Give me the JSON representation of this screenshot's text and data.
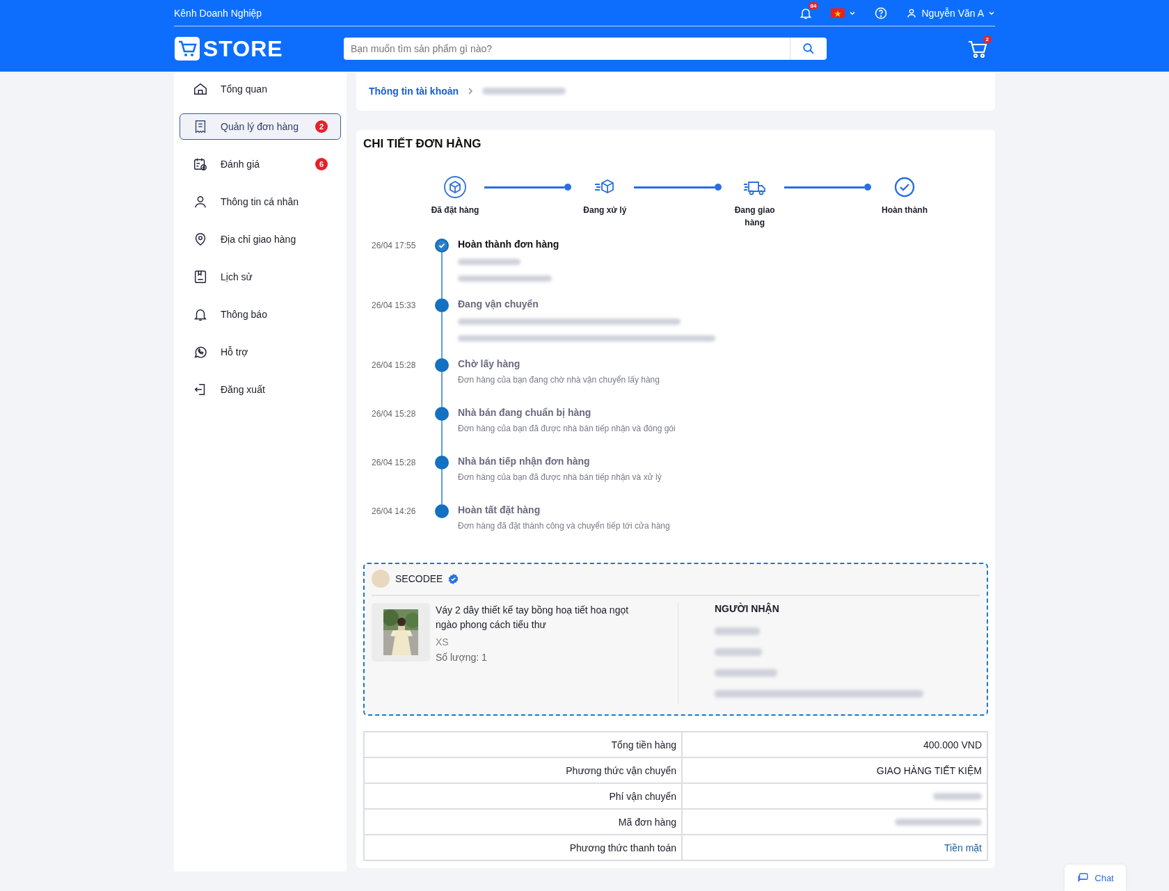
{
  "topbar": {
    "channel_link": "Kênh Doanh Nghiệp",
    "notification_count": "84",
    "user_name": "Nguyễn Văn A"
  },
  "header": {
    "logo_text": "STORE",
    "search": {
      "placeholder": "Bạn muốn tìm sản phẩm gì nào?"
    },
    "cart_count": "2"
  },
  "sidebar": {
    "items": [
      {
        "kind": "home",
        "label": "Tổng quan",
        "selected": false
      },
      {
        "kind": "orders",
        "label": "Quản lý đơn hàng",
        "selected": true,
        "badge": "2"
      },
      {
        "kind": "review",
        "label": "Đánh giá",
        "selected": false,
        "badge": "6"
      },
      {
        "kind": "user",
        "label": "Thông tin cá nhân",
        "selected": false
      },
      {
        "kind": "location",
        "label": "Địa chỉ giao hàng",
        "selected": false
      },
      {
        "kind": "history",
        "label": "Lịch sử",
        "selected": false
      },
      {
        "kind": "bell",
        "label": "Thông báo",
        "selected": false
      },
      {
        "kind": "support",
        "label": "Hỗ trợ",
        "selected": false
      },
      {
        "kind": "logout",
        "label": "Đăng xuất",
        "selected": false
      }
    ]
  },
  "breadcrumb": {
    "link": "Thông tin tài khoản",
    "current_redacted": true
  },
  "order": {
    "title": "CHI TIẾT ĐƠN HÀNG",
    "steps": [
      {
        "kind": "placed",
        "label": "Đã đặt hàng"
      },
      {
        "kind": "processing",
        "label": "Đang xử lý"
      },
      {
        "kind": "shipping",
        "label": "Đang giao hàng"
      },
      {
        "kind": "done",
        "label": "Hoàn thành"
      }
    ],
    "timeline": [
      {
        "time": "26/04 17:55",
        "title": "Hoàn thành đơn hàng",
        "current": true,
        "details": [
          {
            "kind": "redacted"
          },
          {
            "kind": "redacted"
          }
        ]
      },
      {
        "time": "26/04 15:33",
        "title": "Đang vận chuyển",
        "current": false,
        "details": [
          {
            "kind": "redacted"
          },
          {
            "kind": "redacted"
          }
        ]
      },
      {
        "time": "26/04 15:28",
        "title": "Chờ lấy hàng",
        "current": false,
        "details": [
          {
            "kind": "text",
            "text": "Đơn hàng của bạn đang chờ nhà vận chuyển lấy hàng"
          }
        ]
      },
      {
        "time": "26/04 15:28",
        "title": "Nhà bán đang chuẩn bị hàng",
        "current": false,
        "details": [
          {
            "kind": "text",
            "text": "Đơn hàng của bạn đã được nhà bán tiếp nhận và đóng gói"
          }
        ]
      },
      {
        "time": "26/04 15:28",
        "title": "Nhà bán tiếp nhận đơn hàng",
        "current": false,
        "details": [
          {
            "kind": "text",
            "text": "Đơn hàng của bạn đã được nhà bán tiếp nhận và xử lý"
          }
        ]
      },
      {
        "time": "26/04 14:26",
        "title": "Hoàn tất đặt hàng",
        "current": false,
        "details": [
          {
            "kind": "text",
            "text": "Đơn hàng đã đặt thành công và chuyển tiếp tới cửa hàng"
          }
        ]
      }
    ],
    "shop": {
      "name": "SECODEE",
      "verified": true
    },
    "product": {
      "name": "Váy 2 dây thiết kế tay bồng hoạ tiết hoa ngọt ngào phong cách tiểu thư",
      "variant": "XS",
      "quantity": "Số lượng: 1"
    },
    "recipient": {
      "heading": "NGƯỜI NHẬN",
      "lines": [
        {
          "kind": "redacted"
        },
        {
          "kind": "redacted"
        },
        {
          "kind": "redacted"
        },
        {
          "kind": "redacted"
        }
      ]
    },
    "summary": [
      {
        "label": "Tổng tiền hàng",
        "kind": "text",
        "value": "400.000 VND"
      },
      {
        "label": "Phương thức vận chuyển",
        "kind": "text",
        "value": "GIAO HÀNG TIẾT KIỆM"
      },
      {
        "label": "Phí vận chuyển",
        "kind": "redacted"
      },
      {
        "label": "Mã đơn hàng",
        "kind": "redacted"
      },
      {
        "label": "Phương thức thanh toán",
        "kind": "link",
        "value": "Tiền mặt"
      }
    ]
  },
  "chat_button": {
    "label": "Chat"
  }
}
